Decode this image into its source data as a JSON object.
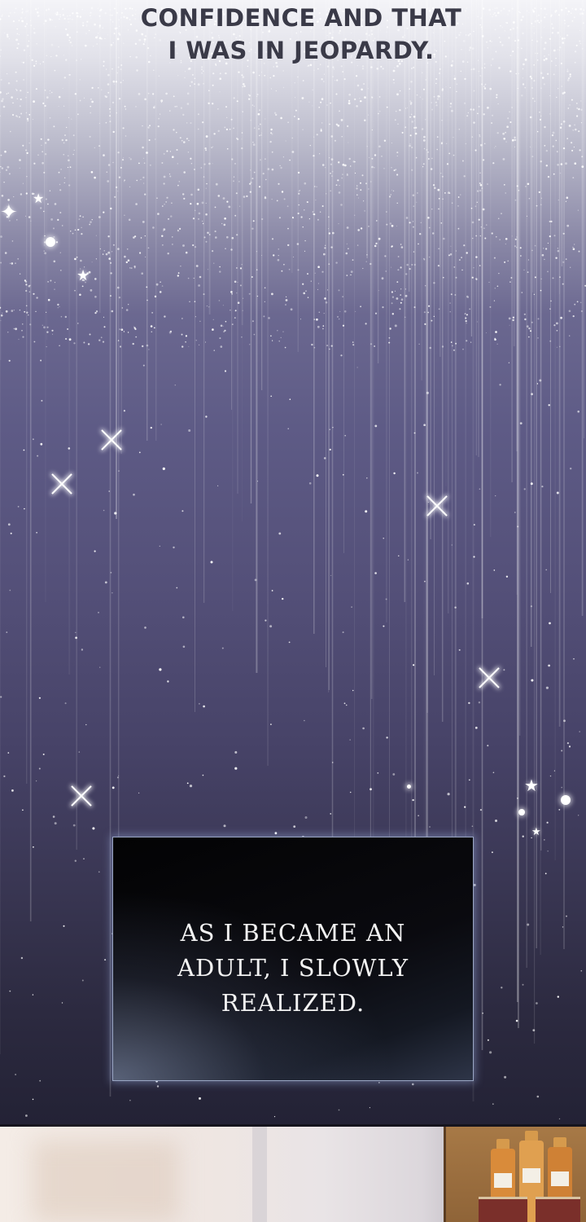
{
  "narration_top": {
    "lines": [
      "CONFIDENCE AND THAT",
      "I WAS IN JEOPARDY."
    ]
  },
  "caption_box": {
    "lines": [
      "AS I BECAME AN",
      "ADULT, I SLOWLY",
      "REALIZED."
    ]
  },
  "colors": {
    "sky_top": "#f4f4f8",
    "sky_mid": "#5e5b86",
    "sky_bottom": "#232235",
    "caption_bg": "#050507",
    "caption_border": "#9aa6c4",
    "caption_text": "#f2f2f2",
    "narration_text": "#3a3a48"
  }
}
